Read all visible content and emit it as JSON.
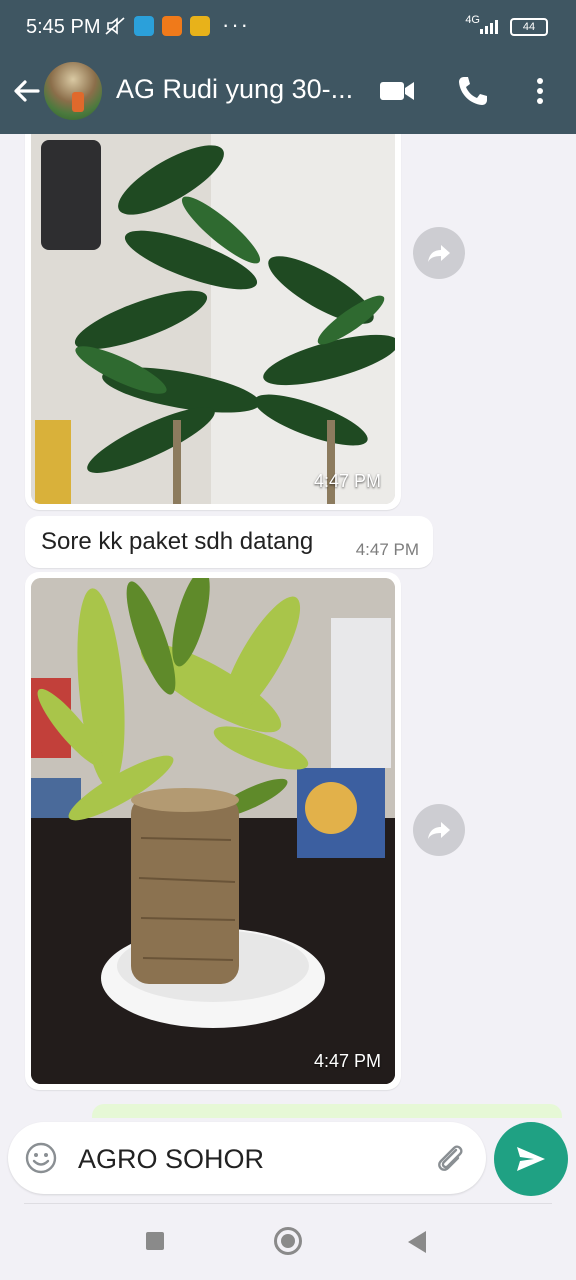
{
  "status_bar": {
    "time": "5:45 PM",
    "more_indicator": "···",
    "network": "4G",
    "battery": "44"
  },
  "header": {
    "title": "AG Rudi yung 30-...",
    "icons": [
      "back-arrow-icon",
      "video-call-icon",
      "voice-call-icon",
      "more-vert-icon"
    ]
  },
  "messages": [
    {
      "type": "image",
      "description": "green dracaena plants",
      "time": "4:47 PM"
    },
    {
      "type": "text",
      "text": "Sore kk paket sdh datang",
      "time": "4:47 PM"
    },
    {
      "type": "image",
      "description": "lucky bamboo trunk in white dish",
      "time": "4:47 PM"
    }
  ],
  "composer": {
    "value": "AGRO SOHOR",
    "icons": [
      "emoji-icon",
      "attach-icon",
      "send-icon"
    ]
  },
  "colors": {
    "header_bg": "#3f5662",
    "chat_bg": "#f2f1f6",
    "send_button": "#1fa183",
    "outgoing_bubble": "#e6f8d6"
  }
}
